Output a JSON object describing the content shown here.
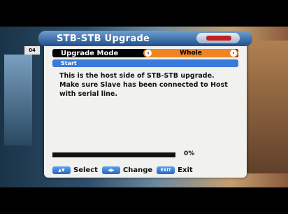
{
  "window": {
    "title": "STB-STB Upgrade",
    "side_tab": "04"
  },
  "mode_row": {
    "label": "Upgrade Mode",
    "value": "Whole",
    "left_arrow": "‹",
    "right_arrow": "›"
  },
  "start": {
    "label": "Start"
  },
  "message": "This is the host side of STB-STB upgrade.\nMake sure Slave has been connected to Host\nwith serial line.",
  "progress": {
    "percent_text": "0%",
    "fraction": 0
  },
  "help": [
    {
      "key": "▲▼",
      "label": "Select",
      "icon": "up-down-key-icon"
    },
    {
      "key": "◀▶",
      "label": "Change",
      "icon": "left-right-key-icon"
    },
    {
      "key": "EXIT",
      "label": "Exit",
      "icon": "exit-key-icon"
    }
  ],
  "colors": {
    "title_blue": "#1f4f8c",
    "selected_orange": "#f08420",
    "highlight_blue": "#3a7ad8",
    "panel": "#f1f1ef"
  }
}
